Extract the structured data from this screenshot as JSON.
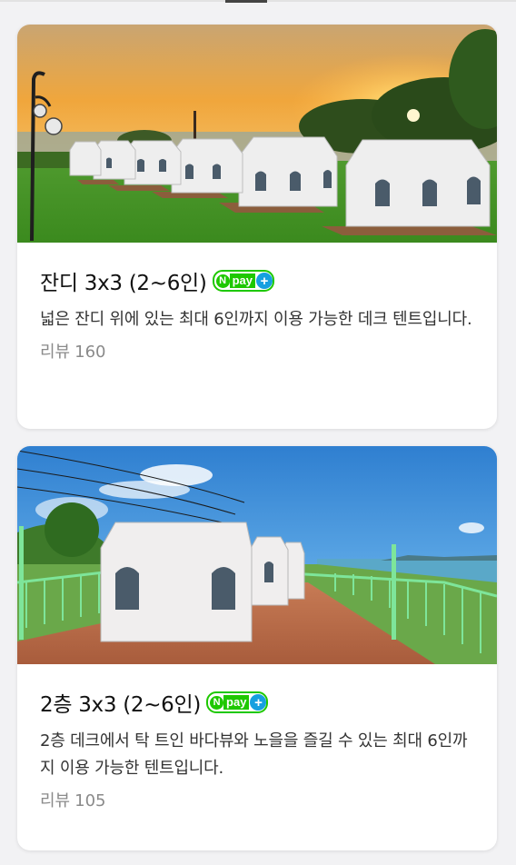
{
  "colors": {
    "npay_green": "#1ec800",
    "npay_plus_blue": "#16a0e0",
    "review_gray": "#8a8a8a"
  },
  "badge": {
    "n": "N",
    "pay": "pay",
    "plus": "+"
  },
  "cards": [
    {
      "title": "잔디 3x3 (2~6인)",
      "description": "넓은 잔디 위에 있는 최대 6인까지 이용 가능한 데크 텐트입니다.",
      "review_label": "리뷰",
      "review_count": "160",
      "image": "sunset-lawn-tent-row"
    },
    {
      "title": "2층 3x3 (2~6인)",
      "description": "2층 데크에서 탁 트인 바다뷰와 노을을 즐길 수 있는 최대 6인까지 이용 가능한 텐트입니다.",
      "review_label": "리뷰",
      "review_count": "105",
      "image": "sea-view-deck-tents"
    }
  ]
}
